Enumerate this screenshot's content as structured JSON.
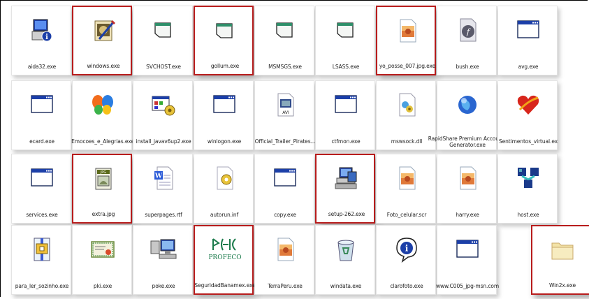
{
  "rows": [
    [
      {
        "label": "aida32.exe",
        "icon": "computer-info-icon",
        "highlighted": false
      },
      {
        "label": "windows.exe",
        "icon": "picture-edit-icon",
        "highlighted": true
      },
      {
        "label": "SVCHOST.exe",
        "icon": "window-icon",
        "highlighted": false
      },
      {
        "label": "gollum.exe",
        "icon": "window-icon",
        "highlighted": true
      },
      {
        "label": "MSMSGS.exe",
        "icon": "window-icon",
        "highlighted": false
      },
      {
        "label": "LSASS.exe",
        "icon": "window-icon",
        "highlighted": false
      },
      {
        "label": "yo_posse_007.jpg.exe",
        "icon": "image-file-icon",
        "highlighted": true
      },
      {
        "label": "bush.exe",
        "icon": "flash-file-icon",
        "highlighted": false
      },
      {
        "label": "avg.exe",
        "icon": "application-window-icon",
        "highlighted": false
      }
    ],
    [
      {
        "label": "ecard.exe",
        "icon": "application-window-icon",
        "highlighted": false
      },
      {
        "label": "Emocoes_e_Alegrias.exe",
        "icon": "msn-butterfly-icon",
        "highlighted": false
      },
      {
        "label": "install_javav6up2.exe",
        "icon": "installer-icon",
        "highlighted": false
      },
      {
        "label": "winlogon.exe",
        "icon": "application-window-icon",
        "highlighted": false
      },
      {
        "label": "Official_Trailer_Pirates...",
        "icon": "avi-file-icon",
        "highlighted": false
      },
      {
        "label": "ctfmon.exe",
        "icon": "application-window-icon",
        "highlighted": false
      },
      {
        "label": "mswsock.dll",
        "icon": "dll-file-icon",
        "highlighted": false
      },
      {
        "label": "RapidShare Premium Accounts Generator.exe",
        "icon": "globe-icon",
        "highlighted": false
      },
      {
        "label": "Sentimentos_virtual.ex",
        "icon": "heart-icon",
        "highlighted": false
      }
    ],
    [
      {
        "label": "services.exe",
        "icon": "application-window-icon",
        "highlighted": false
      },
      {
        "label": "extra.jpg",
        "icon": "jpg-file-icon",
        "highlighted": true
      },
      {
        "label": "superpages.rtf",
        "icon": "word-document-icon",
        "highlighted": false
      },
      {
        "label": "autorun.inf",
        "icon": "settings-file-icon",
        "highlighted": false
      },
      {
        "label": "copy.exe",
        "icon": "application-window-icon",
        "highlighted": false
      },
      {
        "label": "setup-262.exe",
        "icon": "setup-computer-icon",
        "highlighted": true
      },
      {
        "label": "Foto_celular.scr",
        "icon": "image-file-icon",
        "highlighted": false
      },
      {
        "label": "harry.exe",
        "icon": "image-file-icon",
        "highlighted": false
      },
      {
        "label": "host.exe",
        "icon": "network-cubes-icon",
        "highlighted": false
      }
    ],
    [
      {
        "label": "para_ler_sozinho.exe",
        "icon": "compressed-file-icon",
        "highlighted": false
      },
      {
        "label": "pki.exe",
        "icon": "certificate-icon",
        "highlighted": false
      },
      {
        "label": "poke.exe",
        "icon": "computers-icon",
        "highlighted": false
      },
      {
        "label": "SeguridadBanamex.exe",
        "icon": "profeco-logo-icon",
        "logo_text": "PROFECO",
        "highlighted": true
      },
      {
        "label": "TerraPeru.exe",
        "icon": "image-file-icon",
        "highlighted": false
      },
      {
        "label": "windata.exe",
        "icon": "recycle-bin-icon",
        "highlighted": false
      },
      {
        "label": "clarofoto.exe",
        "icon": "info-balloon-icon",
        "highlighted": false
      },
      {
        "label": "www.C005_jpg-msn.com",
        "icon": "application-window-icon",
        "highlighted": false
      },
      {
        "label": "Win2x.exe",
        "icon": "folder-icon",
        "highlighted": true
      }
    ]
  ],
  "colors": {
    "highlight": "#b81c1c",
    "window_title": "#1c3fa8",
    "folder": "#f3e3a8"
  }
}
